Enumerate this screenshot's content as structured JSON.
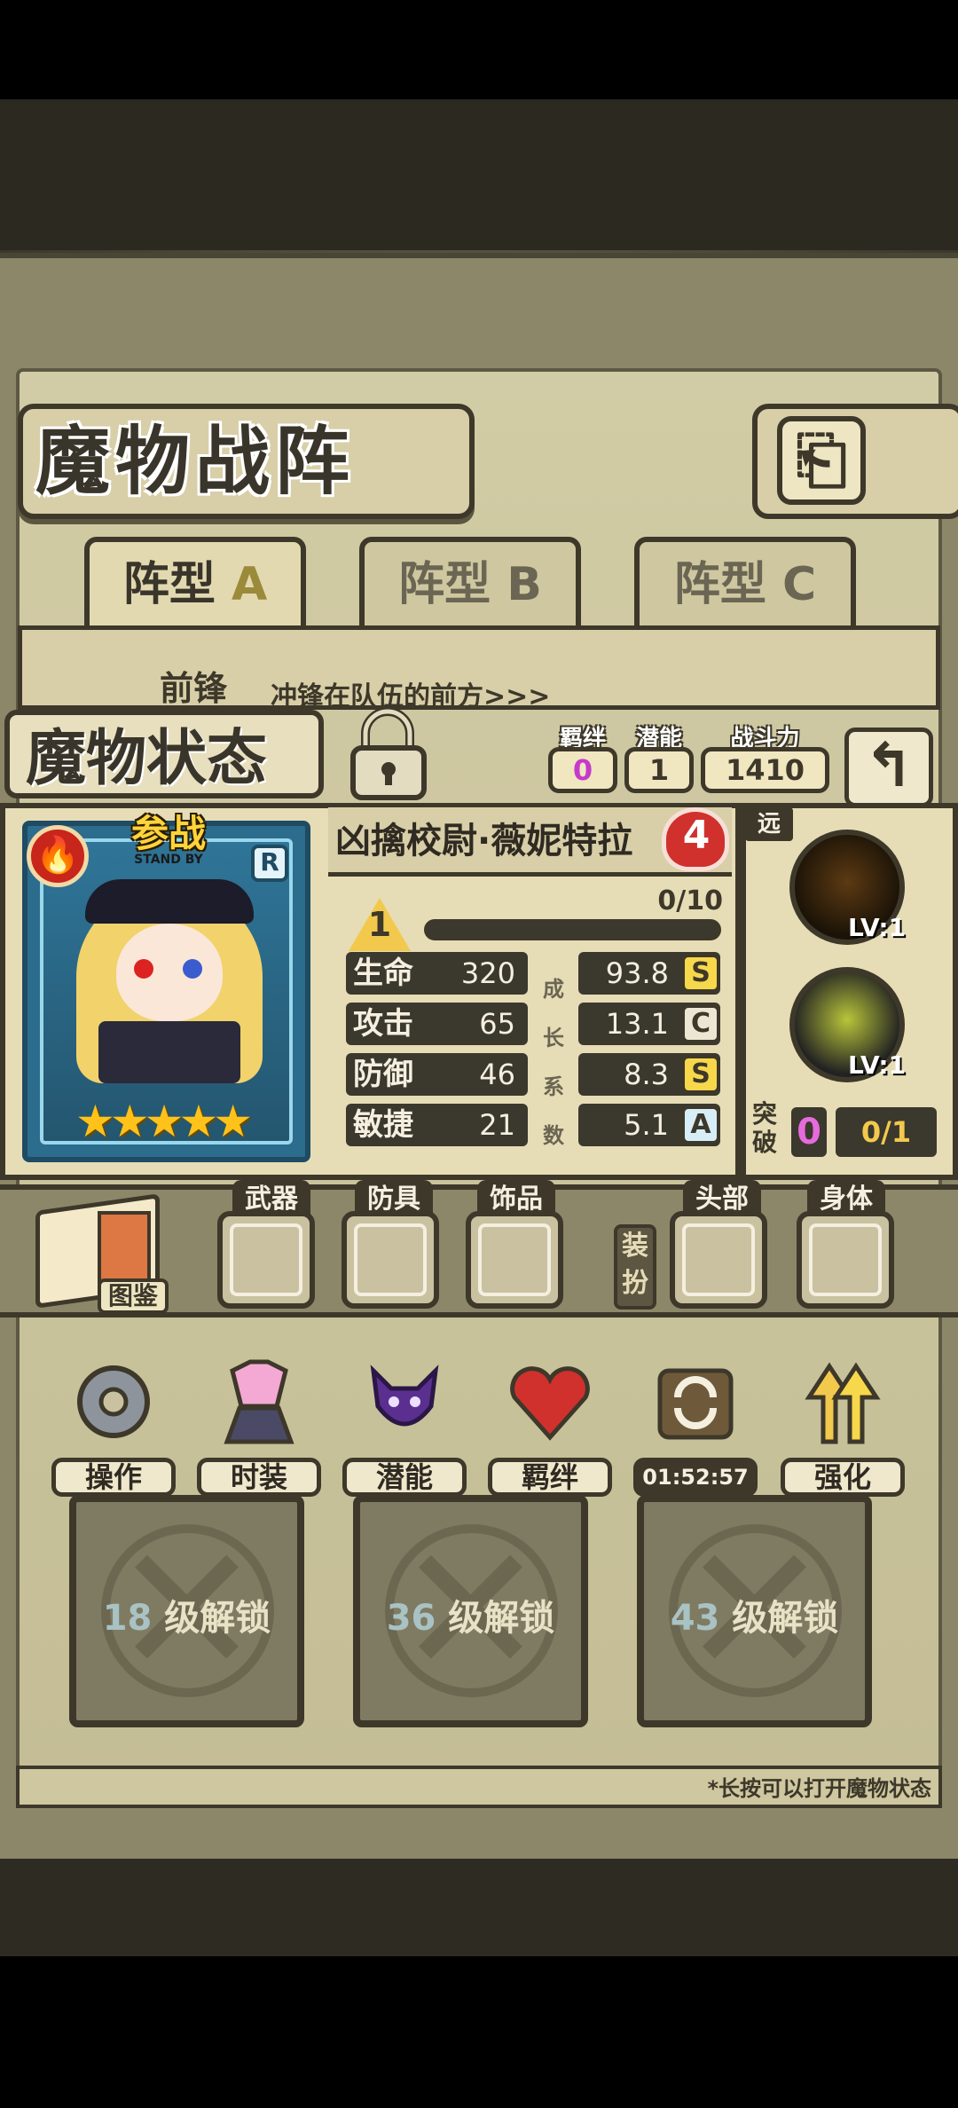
{
  "header": {
    "title": "魔物战阵"
  },
  "tabs": [
    {
      "label": "阵型",
      "suffix": "A",
      "active": true
    },
    {
      "label": "阵型",
      "suffix": "B",
      "active": false
    },
    {
      "label": "阵型",
      "suffix": "C",
      "active": false
    }
  ],
  "formation": {
    "row_label": "前锋",
    "row_desc": "冲锋在队伍的前方>>>"
  },
  "status": {
    "title": "魔物状态",
    "bond_label": "羁绊",
    "bond_value": "0",
    "potential_label": "潜能",
    "potential_value": "1",
    "power_label": "战斗力",
    "power_value": "1410"
  },
  "character": {
    "standby_cn": "参战",
    "standby_en": "STAND BY",
    "rank": "R",
    "stars": "★★★★★",
    "name": "凶擒校尉·薇妮特拉",
    "star_level": "4",
    "level": "1",
    "exp_text": "0/10",
    "exp_fraction": 0,
    "stats": [
      {
        "label": "生命",
        "value": "320",
        "growth": "93.8",
        "grade": "S"
      },
      {
        "label": "攻击",
        "value": "65",
        "growth": "13.1",
        "grade": "C"
      },
      {
        "label": "防御",
        "value": "46",
        "growth": "8.3",
        "grade": "S"
      },
      {
        "label": "敏捷",
        "value": "21",
        "growth": "5.1",
        "grade": "A"
      }
    ],
    "growth_label_chars": [
      "成",
      "长",
      "系",
      "数"
    ]
  },
  "skills": {
    "range": "远",
    "items": [
      {
        "icon": "spark-skill-icon",
        "level": "LV:1"
      },
      {
        "icon": "triple-shot-skill-icon",
        "level": "LV:1"
      }
    ],
    "breakthrough_label": "突破",
    "breakthrough_count": "0",
    "breakthrough_progress": "0/1"
  },
  "equipment": {
    "book_label": "图鉴",
    "slots": [
      {
        "label": "武器"
      },
      {
        "label": "防具"
      },
      {
        "label": "饰品"
      },
      {
        "label": "头部"
      },
      {
        "label": "身体"
      }
    ],
    "dress_label": "装扮"
  },
  "menu": [
    {
      "label": "操作",
      "icon": "gear-icon"
    },
    {
      "label": "时装",
      "icon": "outfit-icon"
    },
    {
      "label": "潜能",
      "icon": "demon-icon"
    },
    {
      "label": "羁绊",
      "icon": "hearts-icon"
    },
    {
      "label": "01:52:57",
      "icon": "refresh-chest-icon"
    },
    {
      "label": "强化",
      "icon": "upgrade-arrows-icon"
    }
  ],
  "locked_slots": [
    {
      "level": "18",
      "text": "级解锁"
    },
    {
      "level": "36",
      "text": "级解锁"
    },
    {
      "level": "43",
      "text": "级解锁"
    }
  ],
  "footer_hint": "*长按可以打开魔物状态",
  "colors": {
    "parchment": "#d8cfa8",
    "ink": "#3d382a",
    "grade_s": "#f7d84b",
    "heart_red": "#d0312d"
  }
}
